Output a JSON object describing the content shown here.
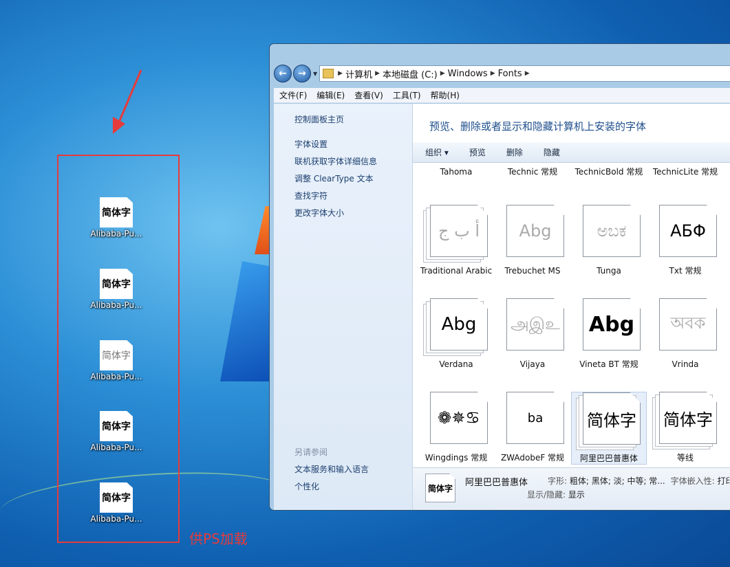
{
  "desktop": {
    "icons": [
      {
        "glyph": "简体字",
        "label": "Alibaba-Pu...",
        "style": "bold"
      },
      {
        "glyph": "简体字",
        "label": "Alibaba-Pu...",
        "style": "bold"
      },
      {
        "glyph": "简体字",
        "label": "Alibaba-Pu...",
        "style": "light"
      },
      {
        "glyph": "简体字",
        "label": "Alibaba-Pu...",
        "style": "bold"
      },
      {
        "glyph": "简体字",
        "label": "Alibaba-Pu...",
        "style": "bold"
      }
    ],
    "annotation": "供PS加载",
    "annotation_color": "#e63b3b"
  },
  "window": {
    "breadcrumbs": [
      "计算机",
      "本地磁盘 (C:)",
      "Windows",
      "Fonts"
    ],
    "menu": [
      "文件(F)",
      "编辑(E)",
      "查看(V)",
      "工具(T)",
      "帮助(H)"
    ],
    "sidebar": {
      "home": "控制面板主页",
      "links": [
        "字体设置",
        "联机获取字体详细信息",
        "调整 ClearType 文本",
        "查找字符",
        "更改字体大小"
      ],
      "see_also_heading": "另请参阅",
      "see_also": [
        "文本服务和输入语言",
        "个性化"
      ]
    },
    "title": "预览、删除或者显示和隐藏计算机上安装的字体",
    "commands": [
      "组织 ▾",
      "预览",
      "删除",
      "隐藏"
    ],
    "font_rows": [
      [
        {
          "label": "Tahoma",
          "sample": ""
        },
        {
          "label": "Technic 常规",
          "sample": ""
        },
        {
          "label": "TechnicBold 常规",
          "sample": ""
        },
        {
          "label": "TechnicLite 常规",
          "sample": ""
        }
      ],
      [
        {
          "label": "Traditional Arabic",
          "sample": "ﺃ ﺏ ﺝ",
          "dim": true,
          "stacked": true
        },
        {
          "label": "Trebuchet MS",
          "sample": "Abg",
          "dim": true,
          "stacked": false
        },
        {
          "label": "Tunga",
          "sample": "ಅಬಕ",
          "dim": true,
          "stacked": false
        },
        {
          "label": "Txt 常规",
          "sample": "AБΦ",
          "dim": false,
          "stacked": false
        }
      ],
      [
        {
          "label": "Verdana",
          "sample": "Abg",
          "dim": false,
          "stacked": true
        },
        {
          "label": "Vijaya",
          "sample": "அஇஉ",
          "dim": true,
          "stacked": false
        },
        {
          "label": "Vineta BT 常规",
          "sample": "Abg",
          "dim": false,
          "stacked": false
        },
        {
          "label": "Vrinda",
          "sample": "অবক",
          "dim": true,
          "stacked": false
        }
      ],
      [
        {
          "label": "Wingdings 常规",
          "sample": "❁✵♋",
          "dim": false,
          "stacked": false
        },
        {
          "label": "ZWAdobeF 常规",
          "sample": "ba",
          "dim": false,
          "stacked": false
        },
        {
          "label": "阿里巴巴普惠体",
          "sample": "简体字",
          "dim": false,
          "stacked": true,
          "selected": true
        },
        {
          "label": "等线",
          "sample": "简体字",
          "dim": false,
          "stacked": true
        }
      ]
    ],
    "details": {
      "thumb": "简体字",
      "name": "阿里巴巴普惠体",
      "style_label": "字形:",
      "style_value": "粗体; 黑体; 淡; 中等; 常...",
      "embed_label": "字体嵌入性:",
      "embed_value": "打印",
      "visibility_label": "显示/隐藏:",
      "visibility_value": "显示"
    }
  }
}
